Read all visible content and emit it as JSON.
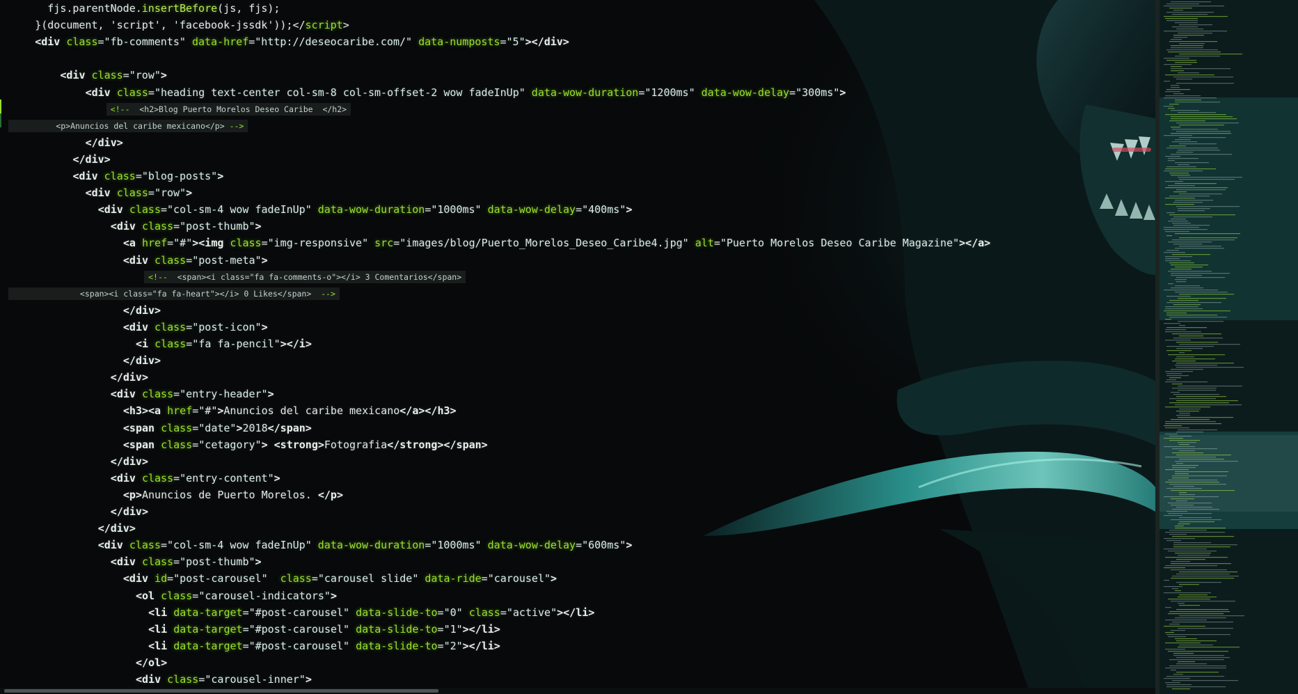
{
  "editor": {
    "theme_colors": {
      "background": "#07090a",
      "tag": "#e6f0ea",
      "attribute": "#98e02e",
      "string": "#d8ece6",
      "accent_teal": "#3cc8c0"
    }
  },
  "code_lines": [
    {
      "indent": 3,
      "parts": [
        [
          "plain",
          "fjs.parentNode."
        ],
        [
          "fn",
          "insertBefore"
        ],
        [
          "plain",
          "(js, fjs);"
        ]
      ]
    },
    {
      "indent": 2,
      "parts": [
        [
          "plain",
          "}(document, 'script', 'facebook-jssdk'));</"
        ],
        [
          "attr",
          "script"
        ],
        [
          "plain",
          ">"
        ]
      ]
    },
    {
      "indent": 2,
      "parts": [
        [
          "tag",
          "<div "
        ],
        [
          "attr",
          "class"
        ],
        [
          "plain",
          "="
        ],
        [
          "str",
          "\"fb-comments\" "
        ],
        [
          "attr",
          "data-href"
        ],
        [
          "plain",
          "="
        ],
        [
          "str",
          "\"http://deseocaribe.com/\" "
        ],
        [
          "attr",
          "data-numposts"
        ],
        [
          "plain",
          "="
        ],
        [
          "str",
          "\"5\""
        ],
        [
          "tag",
          "></div>"
        ]
      ]
    },
    {
      "indent": 0,
      "parts": []
    },
    {
      "indent": 4,
      "parts": [
        [
          "tag",
          "<div "
        ],
        [
          "attr",
          "class"
        ],
        [
          "plain",
          "="
        ],
        [
          "str",
          "\"row\""
        ],
        [
          "tag",
          ">"
        ]
      ]
    },
    {
      "indent": 6,
      "parts": [
        [
          "tag",
          "<div "
        ],
        [
          "attr",
          "class"
        ],
        [
          "plain",
          "="
        ],
        [
          "str",
          "\"heading text-center col-sm-8 col-sm-offset-2 wow fadeInUp\" "
        ],
        [
          "attr",
          "data-wow-duration"
        ],
        [
          "plain",
          "="
        ],
        [
          "str",
          "\"1200ms\" "
        ],
        [
          "attr",
          "data-wow-delay"
        ],
        [
          "plain",
          "="
        ],
        [
          "str",
          "\"300ms\""
        ],
        [
          "tag",
          ">"
        ]
      ]
    },
    {
      "comment": true,
      "indent": 8,
      "parts": [
        [
          "cmt-g",
          "<!-- "
        ],
        [
          "cmt",
          " <h2>Blog Puerto Morelos Deseo Caribe  </h2>"
        ]
      ]
    },
    {
      "comment": true,
      "indent": 0,
      "parts": [
        [
          "cmt",
          "         <p>Anuncios del caribe mexicano</p> "
        ],
        [
          "cmt-g",
          "-->"
        ]
      ]
    },
    {
      "indent": 6,
      "parts": [
        [
          "tag",
          "</div>"
        ]
      ]
    },
    {
      "indent": 5,
      "parts": [
        [
          "tag",
          "</div>"
        ]
      ]
    },
    {
      "indent": 5,
      "parts": [
        [
          "tag",
          "<div "
        ],
        [
          "attr",
          "class"
        ],
        [
          "plain",
          "="
        ],
        [
          "str",
          "\"blog-posts\""
        ],
        [
          "tag",
          ">"
        ]
      ]
    },
    {
      "indent": 6,
      "parts": [
        [
          "tag",
          "<div "
        ],
        [
          "attr",
          "class"
        ],
        [
          "plain",
          "="
        ],
        [
          "str",
          "\"row\""
        ],
        [
          "tag",
          ">"
        ]
      ]
    },
    {
      "indent": 7,
      "parts": [
        [
          "tag",
          "<div "
        ],
        [
          "attr",
          "class"
        ],
        [
          "plain",
          "="
        ],
        [
          "str",
          "\"col-sm-4 wow fadeInUp\" "
        ],
        [
          "attr",
          "data-wow-duration"
        ],
        [
          "plain",
          "="
        ],
        [
          "str",
          "\"1000ms\" "
        ],
        [
          "attr",
          "data-wow-delay"
        ],
        [
          "plain",
          "="
        ],
        [
          "str",
          "\"400ms\""
        ],
        [
          "tag",
          ">"
        ]
      ]
    },
    {
      "indent": 8,
      "parts": [
        [
          "tag",
          "<div "
        ],
        [
          "attr",
          "class"
        ],
        [
          "plain",
          "="
        ],
        [
          "str",
          "\"post-thumb\""
        ],
        [
          "tag",
          ">"
        ]
      ]
    },
    {
      "indent": 9,
      "parts": [
        [
          "tag",
          "<a "
        ],
        [
          "attr",
          "href"
        ],
        [
          "plain",
          "="
        ],
        [
          "str",
          "\"#\""
        ],
        [
          "tag",
          "><img "
        ],
        [
          "attr",
          "class"
        ],
        [
          "plain",
          "="
        ],
        [
          "str",
          "\"img-responsive\" "
        ],
        [
          "attr",
          "src"
        ],
        [
          "plain",
          "="
        ],
        [
          "str",
          "\"images/blog/Puerto_Morelos_Deseo_Caribe4.jpg\" "
        ],
        [
          "attr",
          "alt"
        ],
        [
          "plain",
          "="
        ],
        [
          "str",
          "\"Puerto Morelos Deseo Caribe Magazine\""
        ],
        [
          "tag",
          "></a>"
        ]
      ]
    },
    {
      "indent": 9,
      "parts": [
        [
          "tag",
          "<div "
        ],
        [
          "attr",
          "class"
        ],
        [
          "plain",
          "="
        ],
        [
          "str",
          "\"post-meta\""
        ],
        [
          "tag",
          ">"
        ]
      ]
    },
    {
      "comment": true,
      "indent": 11,
      "parts": [
        [
          "cmt-g",
          "<!-- "
        ],
        [
          "cmt",
          " <span><i class=\"fa fa-comments-o\"></i> 3 Comentarios</span>"
        ]
      ]
    },
    {
      "comment": true,
      "indent": 0,
      "parts": [
        [
          "cmt",
          "              <span><i class=\"fa fa-heart\"></i> 0 Likes</span>  "
        ],
        [
          "cmt-g",
          "-->"
        ]
      ]
    },
    {
      "indent": 9,
      "parts": [
        [
          "tag",
          "</div>"
        ]
      ]
    },
    {
      "indent": 9,
      "parts": [
        [
          "tag",
          "<div "
        ],
        [
          "attr",
          "class"
        ],
        [
          "plain",
          "="
        ],
        [
          "str",
          "\"post-icon\""
        ],
        [
          "tag",
          ">"
        ]
      ]
    },
    {
      "indent": 10,
      "parts": [
        [
          "tag",
          "<i "
        ],
        [
          "attr",
          "class"
        ],
        [
          "plain",
          "="
        ],
        [
          "str",
          "\"fa fa-pencil\""
        ],
        [
          "tag",
          "></i>"
        ]
      ]
    },
    {
      "indent": 9,
      "parts": [
        [
          "tag",
          "</div>"
        ]
      ]
    },
    {
      "indent": 8,
      "parts": [
        [
          "tag",
          "</div>"
        ]
      ]
    },
    {
      "indent": 8,
      "parts": [
        [
          "tag",
          "<div "
        ],
        [
          "attr",
          "class"
        ],
        [
          "plain",
          "="
        ],
        [
          "str",
          "\"entry-header\""
        ],
        [
          "tag",
          ">"
        ]
      ]
    },
    {
      "indent": 9,
      "parts": [
        [
          "tag",
          "<h3><a "
        ],
        [
          "attr",
          "href"
        ],
        [
          "plain",
          "="
        ],
        [
          "str",
          "\"#\""
        ],
        [
          "tag",
          ">"
        ],
        [
          "plain",
          "Anuncios del caribe mexicano"
        ],
        [
          "tag",
          "</a></h3>"
        ]
      ]
    },
    {
      "indent": 9,
      "parts": [
        [
          "tag",
          "<span "
        ],
        [
          "attr",
          "class"
        ],
        [
          "plain",
          "="
        ],
        [
          "str",
          "\"date\""
        ],
        [
          "tag",
          ">"
        ],
        [
          "plain",
          "2018"
        ],
        [
          "tag",
          "</span>"
        ]
      ]
    },
    {
      "indent": 9,
      "parts": [
        [
          "tag",
          "<span "
        ],
        [
          "attr",
          "class"
        ],
        [
          "plain",
          "="
        ],
        [
          "str",
          "\"cetagory\""
        ],
        [
          "tag",
          "> <strong>"
        ],
        [
          "plain",
          "Fotografia"
        ],
        [
          "tag",
          "</strong></span>"
        ]
      ]
    },
    {
      "indent": 8,
      "parts": [
        [
          "tag",
          "</div>"
        ]
      ]
    },
    {
      "indent": 8,
      "parts": [
        [
          "tag",
          "<div "
        ],
        [
          "attr",
          "class"
        ],
        [
          "plain",
          "="
        ],
        [
          "str",
          "\"entry-content\""
        ],
        [
          "tag",
          ">"
        ]
      ]
    },
    {
      "indent": 9,
      "parts": [
        [
          "tag",
          "<p>"
        ],
        [
          "plain",
          "Anuncios de Puerto Morelos. "
        ],
        [
          "tag",
          "</p>"
        ]
      ]
    },
    {
      "indent": 8,
      "parts": [
        [
          "tag",
          "</div>"
        ]
      ]
    },
    {
      "indent": 7,
      "parts": [
        [
          "tag",
          "</div>"
        ]
      ]
    },
    {
      "indent": 7,
      "parts": [
        [
          "tag",
          "<div "
        ],
        [
          "attr",
          "class"
        ],
        [
          "plain",
          "="
        ],
        [
          "str",
          "\"col-sm-4 wow fadeInUp\" "
        ],
        [
          "attr",
          "data-wow-duration"
        ],
        [
          "plain",
          "="
        ],
        [
          "str",
          "\"1000ms\" "
        ],
        [
          "attr",
          "data-wow-delay"
        ],
        [
          "plain",
          "="
        ],
        [
          "str",
          "\"600ms\""
        ],
        [
          "tag",
          ">"
        ]
      ]
    },
    {
      "indent": 8,
      "parts": [
        [
          "tag",
          "<div "
        ],
        [
          "attr",
          "class"
        ],
        [
          "plain",
          "="
        ],
        [
          "str",
          "\"post-thumb\""
        ],
        [
          "tag",
          ">"
        ]
      ]
    },
    {
      "indent": 9,
      "parts": [
        [
          "tag",
          "<div "
        ],
        [
          "attr",
          "id"
        ],
        [
          "plain",
          "="
        ],
        [
          "str",
          "\"post-carousel\"  "
        ],
        [
          "attr",
          "class"
        ],
        [
          "plain",
          "="
        ],
        [
          "str",
          "\"carousel slide\" "
        ],
        [
          "attr",
          "data-ride"
        ],
        [
          "plain",
          "="
        ],
        [
          "str",
          "\"carousel\""
        ],
        [
          "tag",
          ">"
        ]
      ]
    },
    {
      "indent": 10,
      "parts": [
        [
          "tag",
          "<ol "
        ],
        [
          "attr",
          "class"
        ],
        [
          "plain",
          "="
        ],
        [
          "str",
          "\"carousel-indicators\""
        ],
        [
          "tag",
          ">"
        ]
      ]
    },
    {
      "indent": 11,
      "parts": [
        [
          "tag",
          "<li "
        ],
        [
          "attr",
          "data-target"
        ],
        [
          "plain",
          "="
        ],
        [
          "str",
          "\"#post-carousel\" "
        ],
        [
          "attr",
          "data-slide-to"
        ],
        [
          "plain",
          "="
        ],
        [
          "str",
          "\"0\" "
        ],
        [
          "attr",
          "class"
        ],
        [
          "plain",
          "="
        ],
        [
          "str",
          "\"active\""
        ],
        [
          "tag",
          "></li>"
        ]
      ]
    },
    {
      "indent": 11,
      "parts": [
        [
          "tag",
          "<li "
        ],
        [
          "attr",
          "data-target"
        ],
        [
          "plain",
          "="
        ],
        [
          "str",
          "\"#post-carousel\" "
        ],
        [
          "attr",
          "data-slide-to"
        ],
        [
          "plain",
          "="
        ],
        [
          "str",
          "\"1\""
        ],
        [
          "tag",
          "></li>"
        ]
      ]
    },
    {
      "indent": 11,
      "parts": [
        [
          "tag",
          "<li "
        ],
        [
          "attr",
          "data-target"
        ],
        [
          "plain",
          "="
        ],
        [
          "str",
          "\"#post-carousel\" "
        ],
        [
          "attr",
          "data-slide-to"
        ],
        [
          "plain",
          "="
        ],
        [
          "str",
          "\"2\""
        ],
        [
          "tag",
          "></li>"
        ]
      ]
    },
    {
      "indent": 10,
      "parts": [
        [
          "tag",
          "</ol>"
        ]
      ]
    },
    {
      "indent": 10,
      "parts": [
        [
          "tag",
          "<div "
        ],
        [
          "attr",
          "class"
        ],
        [
          "plain",
          "="
        ],
        [
          "str",
          "\"carousel-inner\""
        ],
        [
          "tag",
          ">"
        ]
      ]
    }
  ]
}
